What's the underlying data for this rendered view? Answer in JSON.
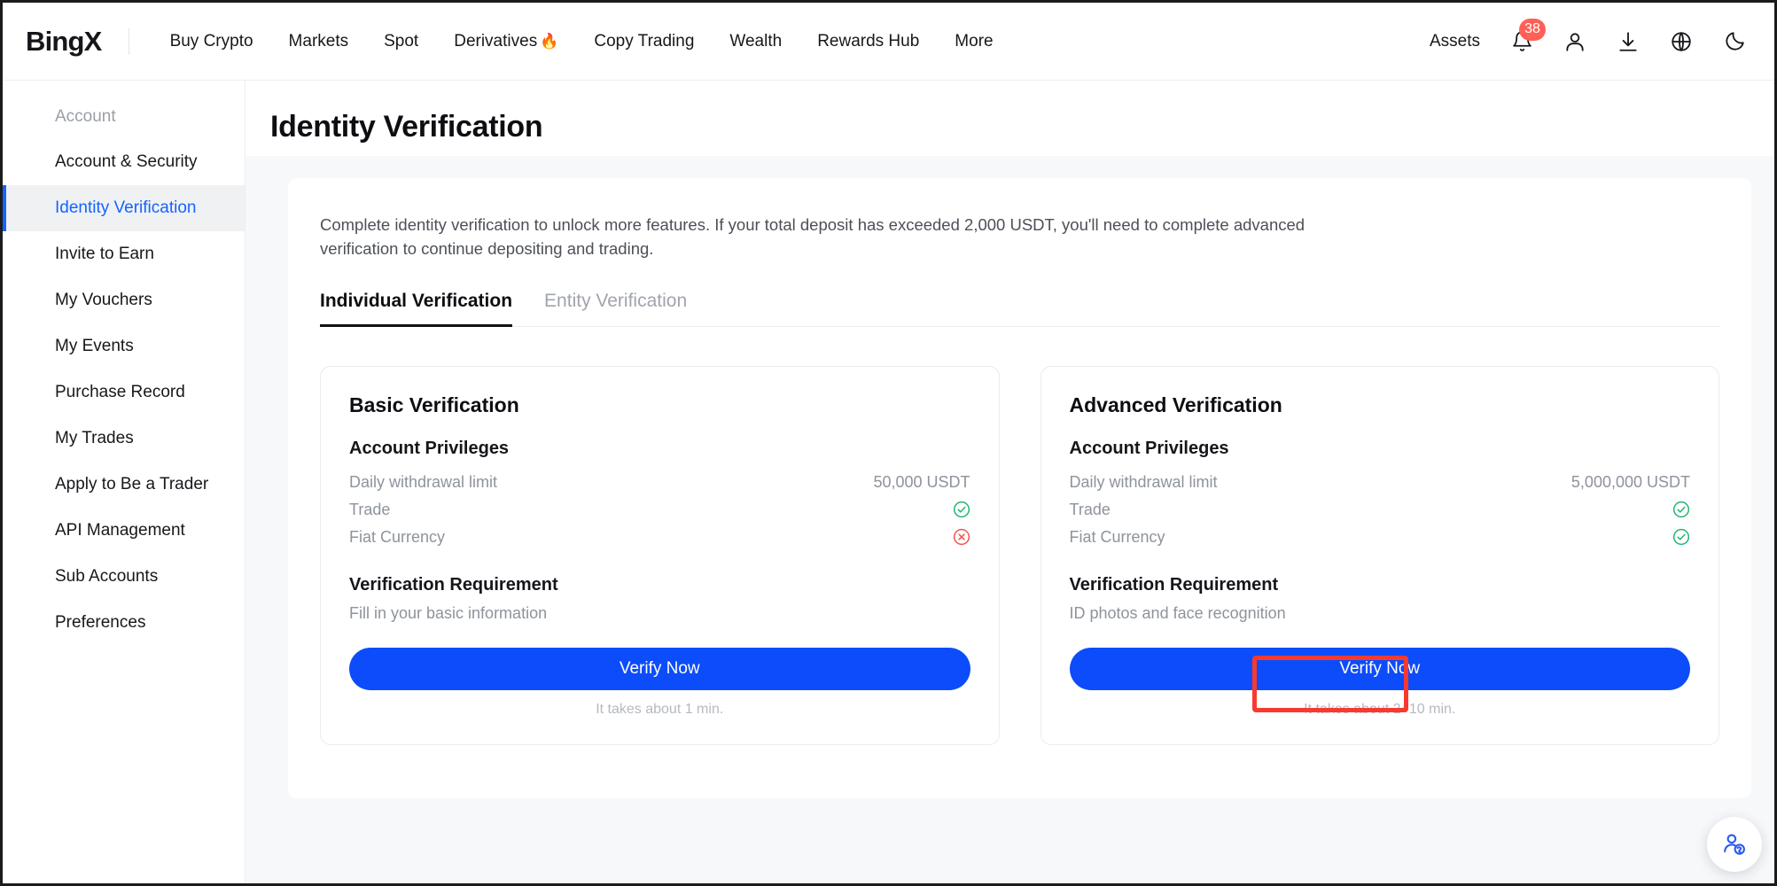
{
  "header": {
    "logo": "BingX",
    "nav": [
      {
        "label": "Buy Crypto",
        "icon": ""
      },
      {
        "label": "Markets",
        "icon": ""
      },
      {
        "label": "Spot",
        "icon": ""
      },
      {
        "label": "Derivatives",
        "icon": "🔥"
      },
      {
        "label": "Copy Trading",
        "icon": ""
      },
      {
        "label": "Wealth",
        "icon": ""
      },
      {
        "label": "Rewards Hub",
        "icon": ""
      },
      {
        "label": "More",
        "icon": ""
      }
    ],
    "assets_label": "Assets",
    "notification_count": "38",
    "icons": [
      "bell-icon",
      "user-icon",
      "download-icon",
      "globe-icon",
      "moon-icon"
    ]
  },
  "sidebar": {
    "section_title": "Account",
    "items": [
      {
        "label": "Account & Security",
        "active": false
      },
      {
        "label": "Identity Verification",
        "active": true
      },
      {
        "label": "Invite to Earn",
        "active": false
      },
      {
        "label": "My Vouchers",
        "active": false
      },
      {
        "label": "My Events",
        "active": false
      },
      {
        "label": "Purchase Record",
        "active": false
      },
      {
        "label": "My Trades",
        "active": false
      },
      {
        "label": "Apply to Be a Trader",
        "active": false
      },
      {
        "label": "API Management",
        "active": false
      },
      {
        "label": "Sub Accounts",
        "active": false
      },
      {
        "label": "Preferences",
        "active": false
      }
    ]
  },
  "main": {
    "page_title": "Identity Verification",
    "intro": "Complete identity verification to unlock more features. If your total deposit has exceeded 2,000 USDT, you'll need to complete advanced verification to continue depositing and trading.",
    "tabs": [
      {
        "label": "Individual Verification",
        "active": true
      },
      {
        "label": "Entity Verification",
        "active": false
      }
    ],
    "cards": [
      {
        "title": "Basic Verification",
        "privileges_heading": "Account Privileges",
        "privileges": [
          {
            "label": "Daily withdrawal limit",
            "value": "50,000 USDT",
            "status": ""
          },
          {
            "label": "Trade",
            "value": "",
            "status": "check"
          },
          {
            "label": "Fiat Currency",
            "value": "",
            "status": "cross"
          }
        ],
        "requirement_heading": "Verification Requirement",
        "requirement_text": "Fill in your basic information",
        "button_label": "Verify Now",
        "button_note": "It takes about 1 min."
      },
      {
        "title": "Advanced Verification",
        "privileges_heading": "Account Privileges",
        "privileges": [
          {
            "label": "Daily withdrawal limit",
            "value": "5,000,000 USDT",
            "status": ""
          },
          {
            "label": "Trade",
            "value": "",
            "status": "check"
          },
          {
            "label": "Fiat Currency",
            "value": "",
            "status": "check"
          }
        ],
        "requirement_heading": "Verification Requirement",
        "requirement_text": "ID photos and face recognition",
        "button_label": "Verify Now",
        "button_note": "It takes about 2~10 min."
      }
    ]
  },
  "widgets": {
    "support_icon": "customer-support-icon"
  },
  "colors": {
    "accent_blue": "#0c4cfa",
    "active_nav_blue": "#1464ff",
    "badge_red": "#ff6057",
    "highlight_red": "#f9392f",
    "status_green": "#22b573",
    "status_red": "#f4544a",
    "page_bg": "#f7f8fa"
  }
}
